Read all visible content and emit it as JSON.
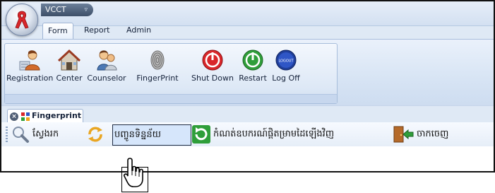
{
  "app": {
    "title": "VCCT",
    "dropdown_glyph": "▿"
  },
  "menu_tabs": [
    {
      "label": "Form",
      "active": true
    },
    {
      "label": "Report",
      "active": false
    },
    {
      "label": "Admin",
      "active": false
    }
  ],
  "ribbon": {
    "buttons": [
      {
        "label": "Registration",
        "icon": "registration-icon"
      },
      {
        "label": "Center",
        "icon": "house-icon"
      },
      {
        "label": "Counselor",
        "icon": "counselor-icon"
      },
      {
        "label": "FingerPrint",
        "icon": "fingerprint-icon"
      },
      {
        "label": "Shut Down",
        "icon": "power-red-icon"
      },
      {
        "label": "Restart",
        "icon": "power-green-icon"
      },
      {
        "label": "Log Off",
        "icon": "logoff-icon",
        "icon_text": "LOGOUT"
      }
    ]
  },
  "document_tab": {
    "title": "Fingerprint",
    "close_glyph": "×"
  },
  "toolbar": {
    "search_label": "ស្វែងរក",
    "update_label": "បញ្ចូនទិន្នន័យ",
    "reset_label": "កំណត់ឧបករណ៍ផ្តិតម្រាមដៃឡើងវិញ",
    "exit_label": "ចាកចេញ"
  },
  "colors": {
    "accent_red": "#d9262a",
    "accent_green": "#2f9e3a",
    "ribbon_bg": "#dfe9f5"
  }
}
